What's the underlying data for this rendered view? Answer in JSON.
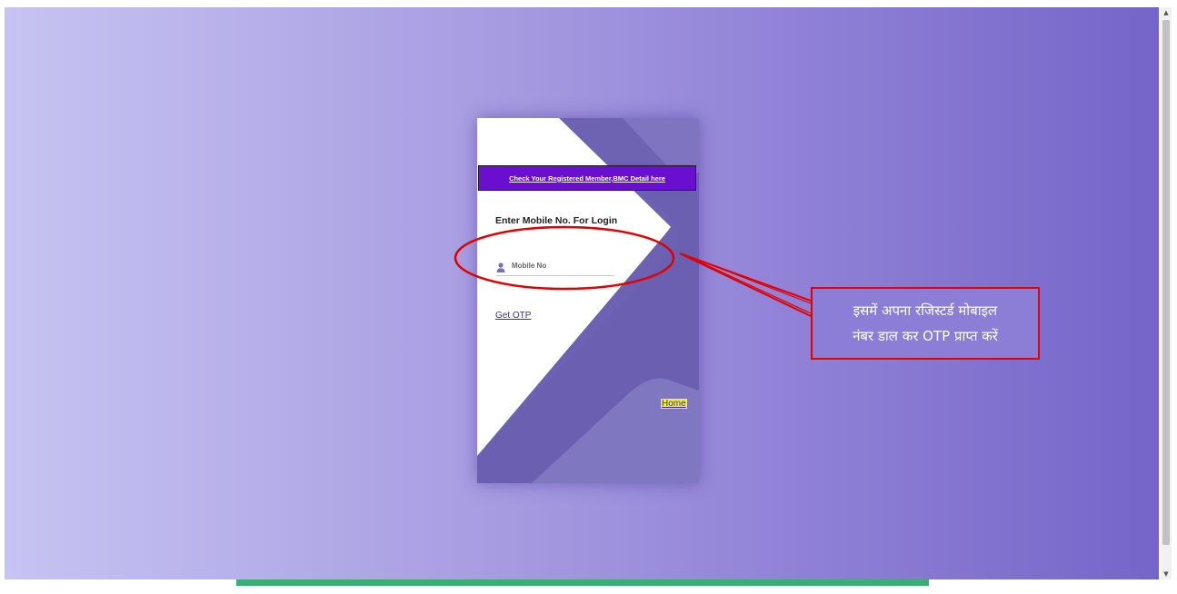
{
  "card": {
    "member_link": "Check Your Registered Member,BMC Detail here",
    "login_title": "Enter Mobile No. For Login",
    "mobile_placeholder": "Mobile No",
    "get_otp": "Get OTP",
    "home": "Home"
  },
  "annotation": {
    "line1": "इसमें अपना रजिस्टर्ड मोबाइल",
    "line2": "नंबर डाल कर OTP प्राप्त करें"
  },
  "icons": {
    "user": "user-icon",
    "scroll_up": "scroll-up-arrow-icon",
    "scroll_down": "scroll-down-arrow-icon"
  },
  "colors": {
    "background_start": "#c6c4f2",
    "background_end": "#7565c9",
    "link_box": "#6a0fd0",
    "annotation_red": "#e10000",
    "home_highlight": "#f2f03a",
    "bottom_bar": "#3aae74"
  }
}
